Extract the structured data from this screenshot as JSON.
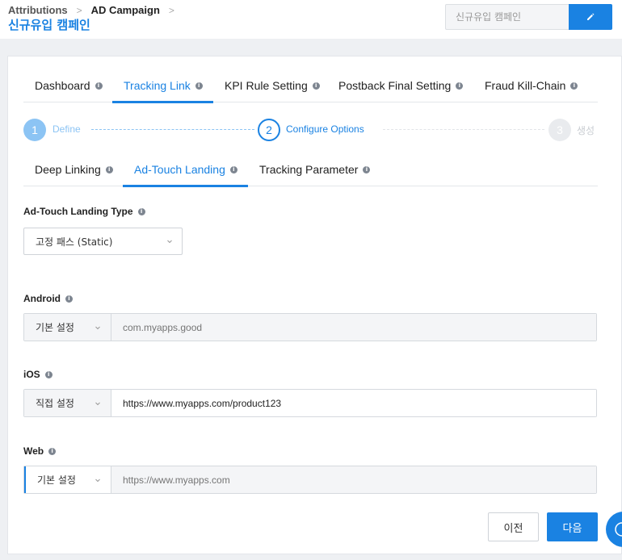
{
  "breadcrumb": {
    "items": [
      "Attributions",
      "AD Campaign"
    ],
    "separator": ">"
  },
  "page": {
    "title": "신규유입 캠페인"
  },
  "campaign_name": {
    "placeholder": "신규유입 캠페인",
    "edit_icon": "pencil-icon"
  },
  "main_tabs": [
    {
      "label": "Dashboard",
      "active": false
    },
    {
      "label": "Tracking Link",
      "active": true
    },
    {
      "label": "KPI Rule Setting",
      "active": false
    },
    {
      "label": "Postback Final Setting",
      "active": false
    },
    {
      "label": "Fraud Kill-Chain",
      "active": false
    }
  ],
  "stepper": {
    "steps": [
      {
        "number": "1",
        "label": "Define",
        "state": "done"
      },
      {
        "number": "2",
        "label": "Configure Options",
        "state": "current"
      },
      {
        "number": "3",
        "label": "생성",
        "state": "todo"
      }
    ]
  },
  "sub_tabs": [
    {
      "label": "Deep Linking",
      "active": false
    },
    {
      "label": "Ad-Touch Landing",
      "active": true
    },
    {
      "label": "Tracking Parameter",
      "active": false
    }
  ],
  "landing_type": {
    "label": "Ad-Touch Landing Type",
    "value": "고정 패스 (Static)"
  },
  "platforms": {
    "android": {
      "label": "Android",
      "mode": "기본 설정",
      "value": "",
      "placeholder": "com.myapps.good"
    },
    "ios": {
      "label": "iOS",
      "mode": "직접 설정",
      "value": "https://www.myapps.com/product123",
      "placeholder": ""
    },
    "web": {
      "label": "Web",
      "mode": "기본 설정",
      "value": "",
      "placeholder": "https://www.myapps.com"
    }
  },
  "buttons": {
    "prev": "이전",
    "next": "다음"
  },
  "colors": {
    "accent": "#1a82e2",
    "step_done": "#8cc4f4",
    "disabled_bg": "#f4f5f7",
    "border": "#d5d9de"
  },
  "icons": {
    "info": "info-icon",
    "chevron": "chevron-down-icon",
    "edit": "pencil-icon",
    "help": "help-icon"
  }
}
